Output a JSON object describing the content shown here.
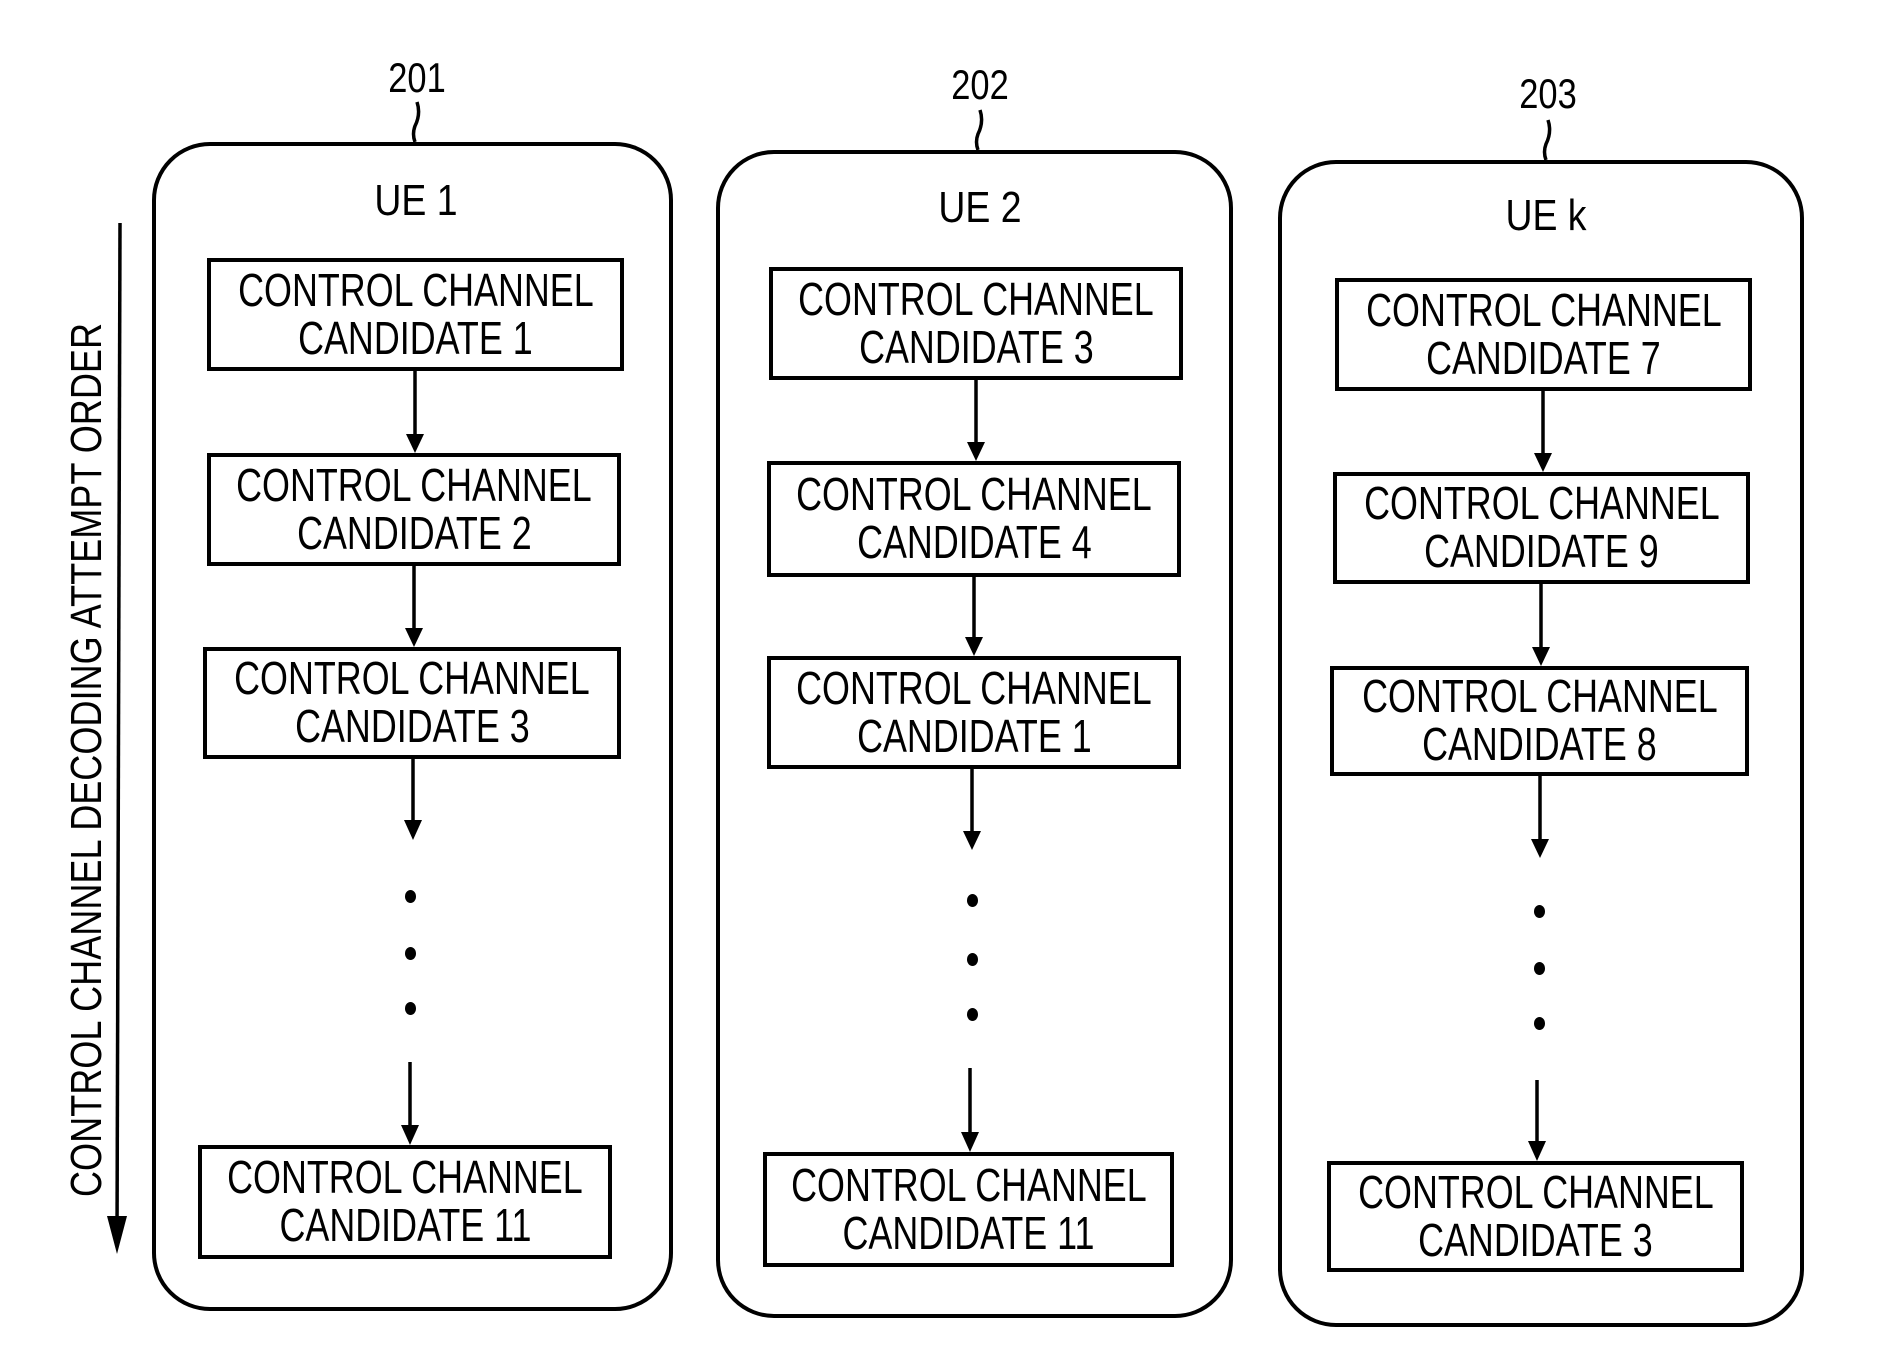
{
  "axis": {
    "label": "CONTROL CHANNEL DECODING ATTEMPT ORDER",
    "direction": "down"
  },
  "panels": [
    {
      "ref": "201",
      "title": "UE 1",
      "candidates": [
        {
          "line1": "CONTROL CHANNEL",
          "line2": "CANDIDATE 1"
        },
        {
          "line1": "CONTROL CHANNEL",
          "line2": "CANDIDATE 2"
        },
        {
          "line1": "CONTROL CHANNEL",
          "line2": "CANDIDATE 3"
        },
        {
          "line1": "CONTROL CHANNEL",
          "line2": "CANDIDATE 11"
        }
      ],
      "ellipsis": "..."
    },
    {
      "ref": "202",
      "title": "UE 2",
      "candidates": [
        {
          "line1": "CONTROL CHANNEL",
          "line2": "CANDIDATE 3"
        },
        {
          "line1": "CONTROL CHANNEL",
          "line2": "CANDIDATE 4"
        },
        {
          "line1": "CONTROL CHANNEL",
          "line2": "CANDIDATE 1"
        },
        {
          "line1": "CONTROL CHANNEL",
          "line2": "CANDIDATE 11"
        }
      ],
      "ellipsis": "..."
    },
    {
      "ref": "203",
      "title": "UE k",
      "candidates": [
        {
          "line1": "CONTROL CHANNEL",
          "line2": "CANDIDATE 7"
        },
        {
          "line1": "CONTROL CHANNEL",
          "line2": "CANDIDATE 9"
        },
        {
          "line1": "CONTROL CHANNEL",
          "line2": "CANDIDATE 8"
        },
        {
          "line1": "CONTROL CHANNEL",
          "line2": "CANDIDATE 3"
        }
      ],
      "ellipsis": "..."
    }
  ]
}
